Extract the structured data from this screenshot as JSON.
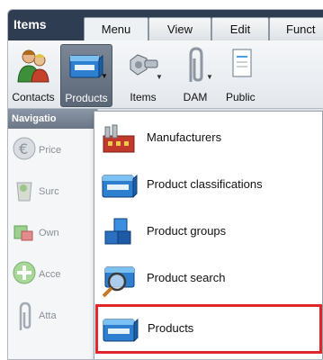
{
  "app": {
    "title": "Items"
  },
  "tabs": [
    {
      "label": "Menu",
      "active": true
    },
    {
      "label": "View",
      "active": false
    },
    {
      "label": "Edit",
      "active": false
    },
    {
      "label": "Funct",
      "active": false
    }
  ],
  "ribbon": {
    "buttons": [
      {
        "label": "Contacts",
        "icon": "contacts-icon",
        "selected": false
      },
      {
        "label": "Products",
        "icon": "product-box-icon",
        "selected": true
      },
      {
        "label": "Items",
        "icon": "bolt-nut-icon",
        "selected": false
      },
      {
        "label": "DAM",
        "icon": "paperclip-icon",
        "selected": false
      },
      {
        "label": "Public",
        "icon": "document-icon",
        "selected": false
      }
    ]
  },
  "navigation": {
    "title": "Navigatio",
    "items": [
      {
        "label": "Price",
        "icon": "euro-icon"
      },
      {
        "label": "Surc",
        "icon": "bin-icon"
      },
      {
        "label": "Own",
        "icon": "blocks-icon"
      },
      {
        "label": "Acce",
        "icon": "plus-icon"
      },
      {
        "label": "Atta",
        "icon": "paperclip-icon"
      }
    ]
  },
  "dropdown": {
    "items": [
      {
        "label": "Manufacturers",
        "icon": "factory-icon",
        "highlighted": false
      },
      {
        "label": "Product classifications",
        "icon": "product-box-icon",
        "highlighted": false
      },
      {
        "label": "Product groups",
        "icon": "cubes-icon",
        "highlighted": false
      },
      {
        "label": "Product search",
        "icon": "magnifier-box-icon",
        "highlighted": false
      },
      {
        "label": "Products",
        "icon": "product-box-icon",
        "highlighted": true
      }
    ]
  },
  "colors": {
    "tabstrip": "#2e3d52",
    "selected_ribbon": "#6b7787",
    "highlight_outline": "#e0252b"
  }
}
